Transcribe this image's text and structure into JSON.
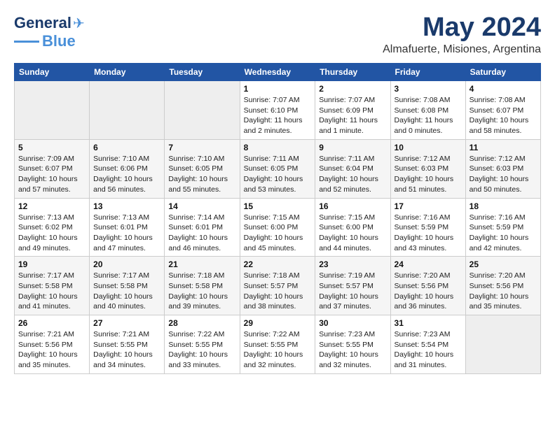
{
  "header": {
    "logo_line1": "General",
    "logo_line2": "Blue",
    "title": "May 2024",
    "subtitle": "Almafuerte, Misiones, Argentina"
  },
  "weekdays": [
    "Sunday",
    "Monday",
    "Tuesday",
    "Wednesday",
    "Thursday",
    "Friday",
    "Saturday"
  ],
  "weeks": [
    [
      {
        "day": "",
        "info": ""
      },
      {
        "day": "",
        "info": ""
      },
      {
        "day": "",
        "info": ""
      },
      {
        "day": "1",
        "info": "Sunrise: 7:07 AM\nSunset: 6:10 PM\nDaylight: 11 hours\nand 2 minutes."
      },
      {
        "day": "2",
        "info": "Sunrise: 7:07 AM\nSunset: 6:09 PM\nDaylight: 11 hours\nand 1 minute."
      },
      {
        "day": "3",
        "info": "Sunrise: 7:08 AM\nSunset: 6:08 PM\nDaylight: 11 hours\nand 0 minutes."
      },
      {
        "day": "4",
        "info": "Sunrise: 7:08 AM\nSunset: 6:07 PM\nDaylight: 10 hours\nand 58 minutes."
      }
    ],
    [
      {
        "day": "5",
        "info": "Sunrise: 7:09 AM\nSunset: 6:07 PM\nDaylight: 10 hours\nand 57 minutes."
      },
      {
        "day": "6",
        "info": "Sunrise: 7:10 AM\nSunset: 6:06 PM\nDaylight: 10 hours\nand 56 minutes."
      },
      {
        "day": "7",
        "info": "Sunrise: 7:10 AM\nSunset: 6:05 PM\nDaylight: 10 hours\nand 55 minutes."
      },
      {
        "day": "8",
        "info": "Sunrise: 7:11 AM\nSunset: 6:05 PM\nDaylight: 10 hours\nand 53 minutes."
      },
      {
        "day": "9",
        "info": "Sunrise: 7:11 AM\nSunset: 6:04 PM\nDaylight: 10 hours\nand 52 minutes."
      },
      {
        "day": "10",
        "info": "Sunrise: 7:12 AM\nSunset: 6:03 PM\nDaylight: 10 hours\nand 51 minutes."
      },
      {
        "day": "11",
        "info": "Sunrise: 7:12 AM\nSunset: 6:03 PM\nDaylight: 10 hours\nand 50 minutes."
      }
    ],
    [
      {
        "day": "12",
        "info": "Sunrise: 7:13 AM\nSunset: 6:02 PM\nDaylight: 10 hours\nand 49 minutes."
      },
      {
        "day": "13",
        "info": "Sunrise: 7:13 AM\nSunset: 6:01 PM\nDaylight: 10 hours\nand 47 minutes."
      },
      {
        "day": "14",
        "info": "Sunrise: 7:14 AM\nSunset: 6:01 PM\nDaylight: 10 hours\nand 46 minutes."
      },
      {
        "day": "15",
        "info": "Sunrise: 7:15 AM\nSunset: 6:00 PM\nDaylight: 10 hours\nand 45 minutes."
      },
      {
        "day": "16",
        "info": "Sunrise: 7:15 AM\nSunset: 6:00 PM\nDaylight: 10 hours\nand 44 minutes."
      },
      {
        "day": "17",
        "info": "Sunrise: 7:16 AM\nSunset: 5:59 PM\nDaylight: 10 hours\nand 43 minutes."
      },
      {
        "day": "18",
        "info": "Sunrise: 7:16 AM\nSunset: 5:59 PM\nDaylight: 10 hours\nand 42 minutes."
      }
    ],
    [
      {
        "day": "19",
        "info": "Sunrise: 7:17 AM\nSunset: 5:58 PM\nDaylight: 10 hours\nand 41 minutes."
      },
      {
        "day": "20",
        "info": "Sunrise: 7:17 AM\nSunset: 5:58 PM\nDaylight: 10 hours\nand 40 minutes."
      },
      {
        "day": "21",
        "info": "Sunrise: 7:18 AM\nSunset: 5:58 PM\nDaylight: 10 hours\nand 39 minutes."
      },
      {
        "day": "22",
        "info": "Sunrise: 7:18 AM\nSunset: 5:57 PM\nDaylight: 10 hours\nand 38 minutes."
      },
      {
        "day": "23",
        "info": "Sunrise: 7:19 AM\nSunset: 5:57 PM\nDaylight: 10 hours\nand 37 minutes."
      },
      {
        "day": "24",
        "info": "Sunrise: 7:20 AM\nSunset: 5:56 PM\nDaylight: 10 hours\nand 36 minutes."
      },
      {
        "day": "25",
        "info": "Sunrise: 7:20 AM\nSunset: 5:56 PM\nDaylight: 10 hours\nand 35 minutes."
      }
    ],
    [
      {
        "day": "26",
        "info": "Sunrise: 7:21 AM\nSunset: 5:56 PM\nDaylight: 10 hours\nand 35 minutes."
      },
      {
        "day": "27",
        "info": "Sunrise: 7:21 AM\nSunset: 5:55 PM\nDaylight: 10 hours\nand 34 minutes."
      },
      {
        "day": "28",
        "info": "Sunrise: 7:22 AM\nSunset: 5:55 PM\nDaylight: 10 hours\nand 33 minutes."
      },
      {
        "day": "29",
        "info": "Sunrise: 7:22 AM\nSunset: 5:55 PM\nDaylight: 10 hours\nand 32 minutes."
      },
      {
        "day": "30",
        "info": "Sunrise: 7:23 AM\nSunset: 5:55 PM\nDaylight: 10 hours\nand 32 minutes."
      },
      {
        "day": "31",
        "info": "Sunrise: 7:23 AM\nSunset: 5:54 PM\nDaylight: 10 hours\nand 31 minutes."
      },
      {
        "day": "",
        "info": ""
      }
    ]
  ]
}
